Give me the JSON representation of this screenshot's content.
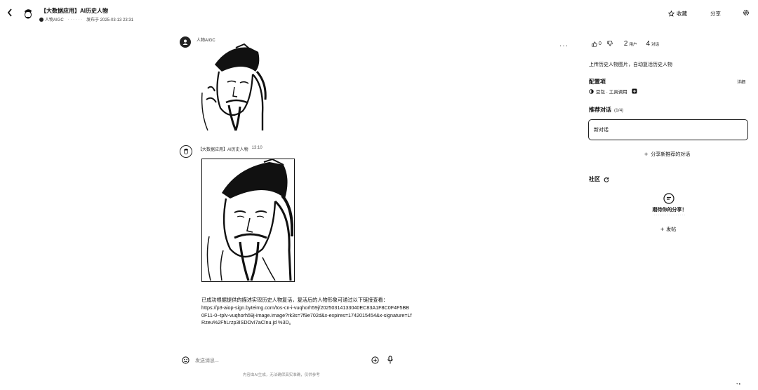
{
  "header": {
    "back_icon": "chevron-left-icon",
    "title": "【大数据应用】AI历史人物",
    "author": "人物AIGC",
    "meta_mid": "· · · · · ·",
    "published": "发布于 2025-03-13 23:31",
    "favorite_label": "收藏",
    "share_label": "分享",
    "settings_icon": "gear-icon"
  },
  "chat": {
    "msg1": {
      "sender": "人物AIGC"
    },
    "msg2": {
      "sender": "【大数据应用】AI历史人物",
      "time": "13:10",
      "text_intro": "已成功根据提供的描述实现历史人物复活，复活后的人物形象可通过以下链接查看：",
      "text_url": "https://p3-aiop-sign.byteimg.com/tos-cn-i-vuqhorh59j/20250314133040EC83A1F8C0F4F5BB0F11-0~tplv-vuqhorh59j-image.image?rk3s=7f9e702d&x-expires=1742015454&x-signature=LfRzeu%2FhLrzp3ISDOvI7aClnu.jd %3D",
      "text_end": "。"
    },
    "more_icon": "more-icon",
    "input_placeholder": "发送消息...",
    "disclaimer": "内容由AI生成，无法确保真实准确，仅供参考"
  },
  "panel": {
    "likes": "0",
    "users_count": "2",
    "users_label": "用户",
    "chats_count": "4",
    "chats_label": "对话",
    "description": "上传历史人物图片，自动复活历史人物",
    "config_title": "配置项",
    "config_detail": "详细",
    "config_item": "豆包 · 工具调用",
    "recommend_title": "推荐对话",
    "recommend_count": "(1/4)",
    "new_chat_label": "新对话",
    "share_recommend": "分享新推荐的对话",
    "community_title": "社区",
    "community_empty_title": "期待你的分享！",
    "community_empty_sub": "· · · · · · · · · · · · · · ·",
    "publish_label": "发帖"
  }
}
